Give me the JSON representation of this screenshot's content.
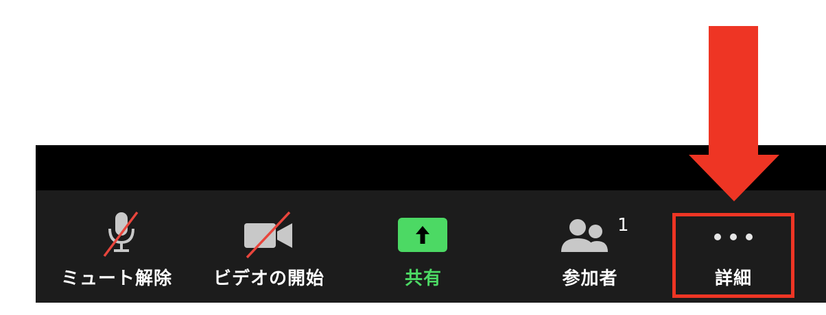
{
  "toolbar": {
    "unmute_label": "ミュート解除",
    "start_video_label": "ビデオの開始",
    "share_label": "共有",
    "participants_label": "参加者",
    "participants_count": "1",
    "more_label": "詳細"
  },
  "colors": {
    "toolbar_bg": "#1c1c1c",
    "share_green": "#4cd964",
    "annotation_red": "#ee3524"
  },
  "icons": {
    "unmute": "microphone-muted-icon",
    "video": "video-camera-off-icon",
    "share": "share-screen-up-arrow-icon",
    "participants": "participants-icon",
    "more": "more-ellipsis-icon",
    "annotation": "red-down-arrow"
  }
}
